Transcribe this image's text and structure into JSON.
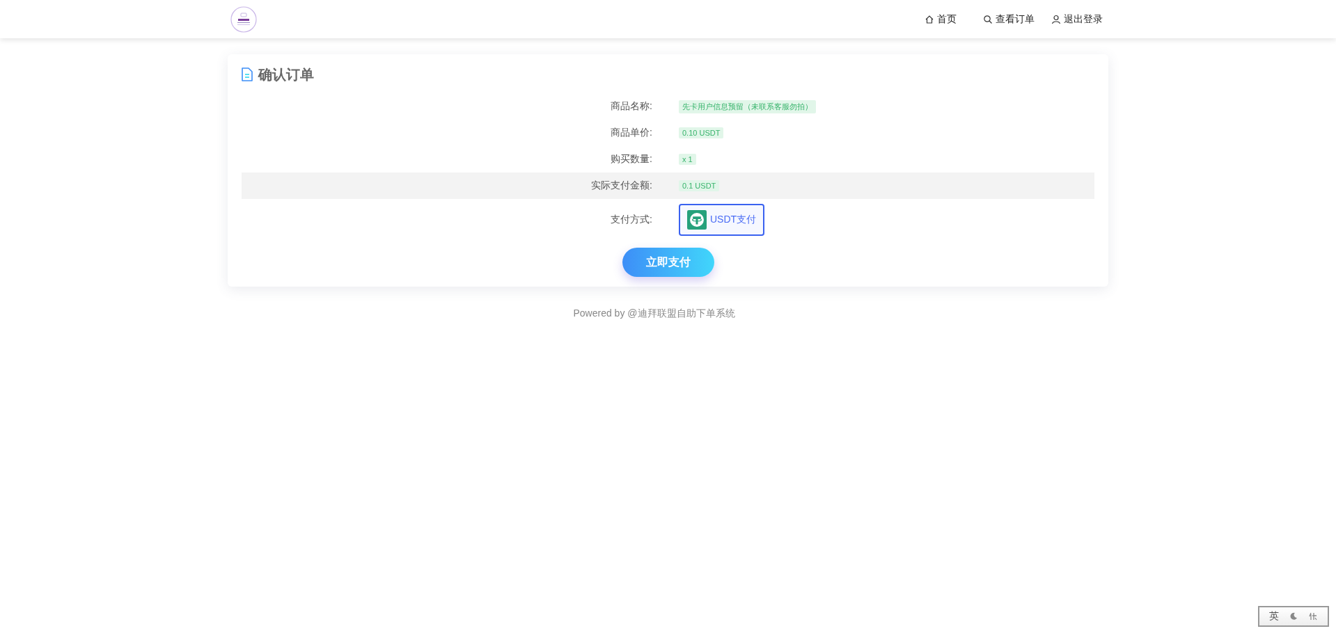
{
  "nav": [
    {
      "kind": "home",
      "label": "首页"
    },
    {
      "kind": "search",
      "label": "查看订单"
    },
    {
      "kind": "user",
      "label": "退出登录"
    }
  ],
  "card": {
    "title": "确认订单",
    "rows": [
      {
        "label": "商品名称:",
        "value": "先卡用户信息预留（未联系客服勿拍）",
        "highlighted": false
      },
      {
        "label": "商品单价:",
        "value": "0.10 USDT",
        "highlighted": false
      },
      {
        "label": "购买数量:",
        "value": "x 1",
        "highlighted": false
      },
      {
        "label": "实际支付金额:",
        "value": "0.1 USDT",
        "highlighted": true
      }
    ],
    "payment": {
      "label": "支付方式:",
      "options": [
        {
          "label": "USDT支付",
          "selected": true
        }
      ]
    },
    "submit": "立即支付"
  },
  "footer": "Powered by @迪拜联盟自助下单系统",
  "ime": {
    "mode": "英"
  }
}
